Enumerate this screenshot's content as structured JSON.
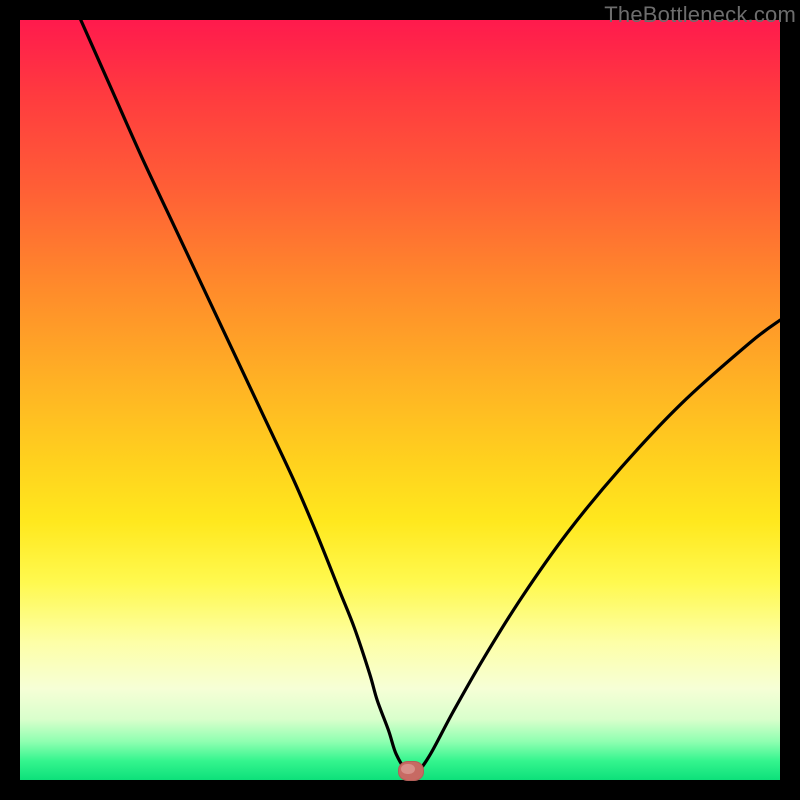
{
  "watermark": "TheBottleneck.com",
  "colors": {
    "frame": "#000000",
    "curve": "#000000",
    "marker_fill": "#c76a63",
    "marker_highlight": "#d88f89"
  },
  "chart_data": {
    "type": "line",
    "title": "",
    "xlabel": "",
    "ylabel": "",
    "xlim": [
      0,
      100
    ],
    "ylim": [
      0,
      100
    ],
    "grid": false,
    "note": "No axis ticks or numeric labels are shown; values below are read off the plot geometry on a 0–100 normalized scale for each axis.",
    "series": [
      {
        "name": "bottleneck-curve",
        "x": [
          8,
          12,
          16,
          20,
          24,
          28,
          32,
          36,
          39,
          42,
          44,
          46,
          47,
          48.5,
          49.5,
          51,
          52.3,
          54,
          57,
          61,
          66,
          72,
          79,
          87,
          96,
          100
        ],
        "y": [
          100,
          91,
          82,
          73.5,
          65,
          56.5,
          48,
          39.5,
          32.5,
          25,
          20,
          14,
          10.5,
          6.5,
          3.4,
          1.1,
          1.1,
          3.4,
          9,
          16,
          24,
          32.5,
          41,
          49.5,
          57.5,
          60.5
        ]
      }
    ],
    "marker": {
      "name": "selected-point",
      "x": 51.5,
      "y": 1.2
    }
  }
}
